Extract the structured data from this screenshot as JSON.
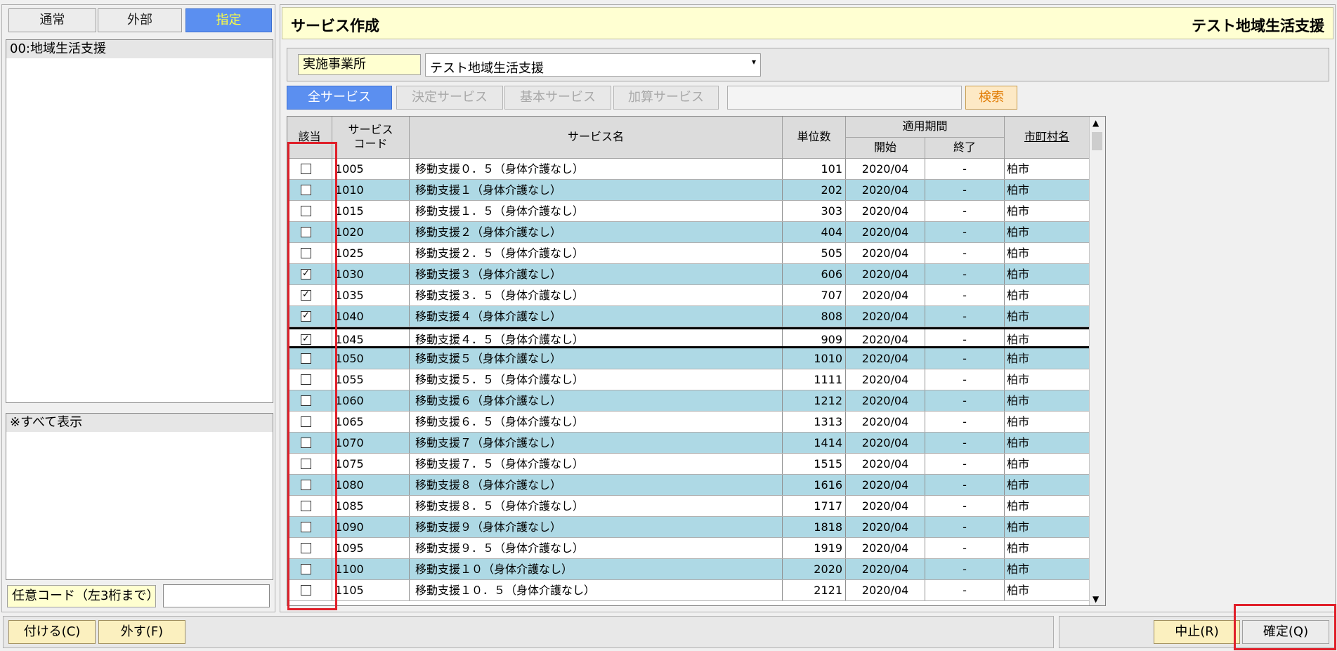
{
  "left": {
    "tabs": [
      "通常",
      "外部",
      "指定"
    ],
    "active_tab": "指定",
    "list1": [
      "00:地域生活支援"
    ],
    "list2": [
      "※すべて表示"
    ],
    "code_label": "任意コード（左3桁まで）",
    "code_value": ""
  },
  "header": {
    "title": "サービス作成",
    "subtitle": "テスト地域生活支援"
  },
  "office": {
    "label": "実施事業所",
    "value": "テスト地域生活支援"
  },
  "filters": {
    "buttons": [
      "全サービス",
      "決定サービス",
      "基本サービス",
      "加算サービス"
    ],
    "active": "全サービス",
    "search_value": "",
    "search_label": "検索"
  },
  "table": {
    "headers": {
      "applies": "該当",
      "code_line1": "サービス",
      "code_line2": "コード",
      "name": "サービス名",
      "units": "単位数",
      "period": "適用期間",
      "start": "開始",
      "end": "終了",
      "city": "市町村名"
    },
    "rows": [
      {
        "checked": false,
        "code": "1005",
        "name": "移動支援０．５（身体介護なし）",
        "units": "101",
        "start": "2020/04",
        "end": "-",
        "city": "柏市"
      },
      {
        "checked": false,
        "code": "1010",
        "name": "移動支援１（身体介護なし）",
        "units": "202",
        "start": "2020/04",
        "end": "-",
        "city": "柏市"
      },
      {
        "checked": false,
        "code": "1015",
        "name": "移動支援１．５（身体介護なし）",
        "units": "303",
        "start": "2020/04",
        "end": "-",
        "city": "柏市"
      },
      {
        "checked": false,
        "code": "1020",
        "name": "移動支援２（身体介護なし）",
        "units": "404",
        "start": "2020/04",
        "end": "-",
        "city": "柏市"
      },
      {
        "checked": false,
        "code": "1025",
        "name": "移動支援２．５（身体介護なし）",
        "units": "505",
        "start": "2020/04",
        "end": "-",
        "city": "柏市"
      },
      {
        "checked": true,
        "code": "1030",
        "name": "移動支援３（身体介護なし）",
        "units": "606",
        "start": "2020/04",
        "end": "-",
        "city": "柏市"
      },
      {
        "checked": true,
        "code": "1035",
        "name": "移動支援３．５（身体介護なし）",
        "units": "707",
        "start": "2020/04",
        "end": "-",
        "city": "柏市"
      },
      {
        "checked": true,
        "code": "1040",
        "name": "移動支援４（身体介護なし）",
        "units": "808",
        "start": "2020/04",
        "end": "-",
        "city": "柏市"
      },
      {
        "checked": true,
        "code": "1045",
        "name": "移動支援４．５（身体介護なし）",
        "units": "909",
        "start": "2020/04",
        "end": "-",
        "city": "柏市",
        "selected": true
      },
      {
        "checked": false,
        "code": "1050",
        "name": "移動支援５（身体介護なし）",
        "units": "1010",
        "start": "2020/04",
        "end": "-",
        "city": "柏市"
      },
      {
        "checked": false,
        "code": "1055",
        "name": "移動支援５．５（身体介護なし）",
        "units": "1111",
        "start": "2020/04",
        "end": "-",
        "city": "柏市"
      },
      {
        "checked": false,
        "code": "1060",
        "name": "移動支援６（身体介護なし）",
        "units": "1212",
        "start": "2020/04",
        "end": "-",
        "city": "柏市"
      },
      {
        "checked": false,
        "code": "1065",
        "name": "移動支援６．５（身体介護なし）",
        "units": "1313",
        "start": "2020/04",
        "end": "-",
        "city": "柏市"
      },
      {
        "checked": false,
        "code": "1070",
        "name": "移動支援７（身体介護なし）",
        "units": "1414",
        "start": "2020/04",
        "end": "-",
        "city": "柏市"
      },
      {
        "checked": false,
        "code": "1075",
        "name": "移動支援７．５（身体介護なし）",
        "units": "1515",
        "start": "2020/04",
        "end": "-",
        "city": "柏市"
      },
      {
        "checked": false,
        "code": "1080",
        "name": "移動支援８（身体介護なし）",
        "units": "1616",
        "start": "2020/04",
        "end": "-",
        "city": "柏市"
      },
      {
        "checked": false,
        "code": "1085",
        "name": "移動支援８．５（身体介護なし）",
        "units": "1717",
        "start": "2020/04",
        "end": "-",
        "city": "柏市"
      },
      {
        "checked": false,
        "code": "1090",
        "name": "移動支援９（身体介護なし）",
        "units": "1818",
        "start": "2020/04",
        "end": "-",
        "city": "柏市"
      },
      {
        "checked": false,
        "code": "1095",
        "name": "移動支援９．５（身体介護なし）",
        "units": "1919",
        "start": "2020/04",
        "end": "-",
        "city": "柏市"
      },
      {
        "checked": false,
        "code": "1100",
        "name": "移動支援１０（身体介護なし）",
        "units": "2020",
        "start": "2020/04",
        "end": "-",
        "city": "柏市"
      },
      {
        "checked": false,
        "code": "1105",
        "name": "移動支援１０．５（身体介護なし）",
        "units": "2121",
        "start": "2020/04",
        "end": "-",
        "city": "柏市"
      }
    ]
  },
  "footer": {
    "attach": "付ける(C)",
    "detach": "外す(F)",
    "cancel": "中止(R)",
    "confirm": "確定(Q)"
  },
  "colors": {
    "accent_blue": "#5b8ff0",
    "row_alt": "#aed9e5",
    "header_yellow": "#ffffd2",
    "highlight_red": "#e0202a"
  }
}
